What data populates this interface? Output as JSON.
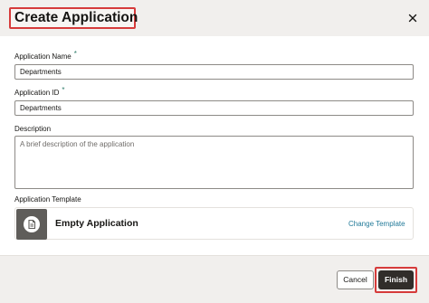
{
  "dialog": {
    "title": "Create Application"
  },
  "form": {
    "app_name": {
      "label": "Application Name",
      "required": "*",
      "value": "Departments"
    },
    "app_id": {
      "label": "Application ID",
      "required": "*",
      "value": "Departments"
    },
    "description": {
      "label": "Description",
      "placeholder": "A brief description of the application"
    },
    "template": {
      "label": "Application Template",
      "name": "Empty Application",
      "change_label": "Change Template"
    }
  },
  "footer": {
    "cancel_label": "Cancel",
    "finish_label": "Finish"
  },
  "icons": {
    "close": "close-icon",
    "template": "document-template-icon"
  }
}
